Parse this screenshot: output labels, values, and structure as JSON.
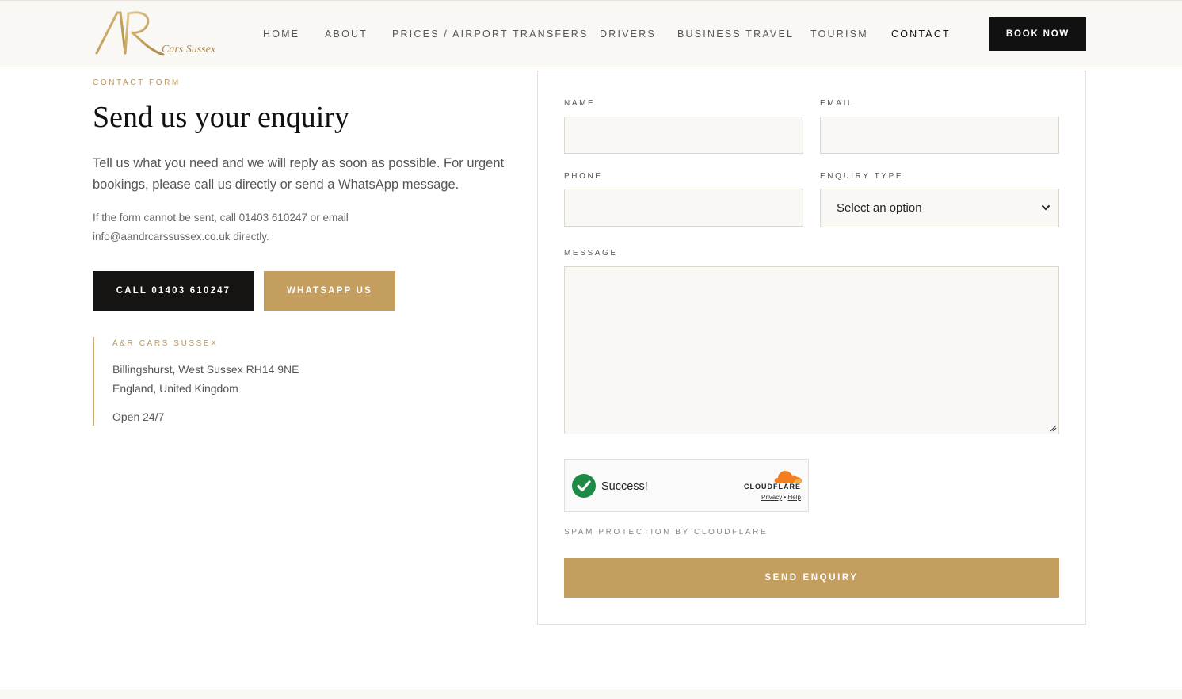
{
  "colors": {
    "gold": "#c49e5f",
    "dark": "#161412",
    "header_bg": "#faf8f4",
    "success_green": "#1e8a45",
    "cloudflare_orange": "#f38020"
  },
  "header": {
    "logo_text": "Cars Sussex",
    "logo_icon": "ar-monogram-logo",
    "nav": [
      {
        "label": "HOME",
        "active": false
      },
      {
        "label": "ABOUT",
        "active": false
      },
      {
        "label": "PRICES / AIRPORT TRANSFERS",
        "active": false
      },
      {
        "label": "DRIVERS",
        "active": false
      },
      {
        "label": "BUSINESS TRAVEL",
        "active": false
      },
      {
        "label": "TOURISM",
        "active": false
      },
      {
        "label": "CONTACT",
        "active": true
      }
    ],
    "book_label": "BOOK NOW"
  },
  "intro": {
    "eyebrow": "CONTACT FORM",
    "title": "Send us your enquiry",
    "lead": "Tell us what you need and we will reply as soon as possible. For urgent bookings, please call us directly or send a WhatsApp message.",
    "fallback_line1": "If the form cannot be sent, call 01403 610247 or email",
    "fallback_line2": "info@aandrcarssussex.co.uk directly.",
    "call_label": "CALL 01403 610247",
    "whatsapp_label": "WHATSAPP US"
  },
  "address": {
    "company": "A&R CARS SUSSEX",
    "line1": "Billingshurst, West Sussex RH14 9NE",
    "line2": "England, United Kingdom",
    "hours": "Open 24/7"
  },
  "form": {
    "name_label": "NAME",
    "name_value": "",
    "email_label": "EMAIL",
    "email_value": "",
    "phone_label": "PHONE",
    "phone_value": "",
    "enquiry_label": "ENQUIRY TYPE",
    "enquiry_selected": "Select an option",
    "message_label": "MESSAGE",
    "message_value": "",
    "captcha_status": "Success!",
    "captcha_brand": "CLOUDFLARE",
    "captcha_privacy": "Privacy",
    "captcha_sep": "•",
    "captcha_help": "Help",
    "spam_note": "SPAM PROTECTION BY CLOUDFLARE",
    "submit_label": "SEND ENQUIRY"
  }
}
